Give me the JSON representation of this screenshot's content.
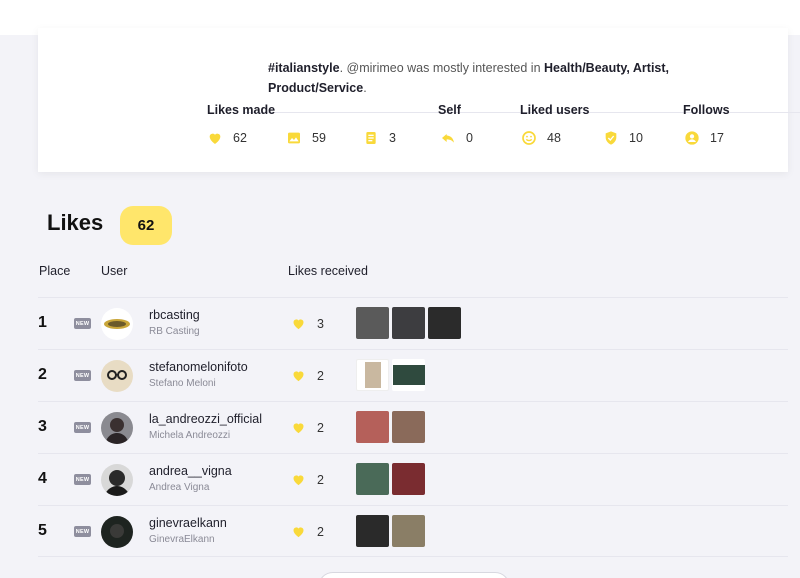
{
  "summary": {
    "hashtag": "#italianstyle",
    "middle_text": ". @mirimeo was mostly interested in ",
    "categories_bold": "Health/Beauty, Artist,",
    "last_category": "Product/Service",
    "end_text": "."
  },
  "stats": {
    "likes_made_label": "Likes made",
    "self_label": "Self",
    "liked_users_label": "Liked users",
    "follows_label": "Follows",
    "items": [
      {
        "icon": "heart-icon",
        "value": "62"
      },
      {
        "icon": "image-icon",
        "value": "59"
      },
      {
        "icon": "document-icon",
        "value": "3"
      },
      {
        "icon": "reply-icon",
        "value": "0"
      },
      {
        "icon": "smiley-icon",
        "value": "48"
      },
      {
        "icon": "shield-check-icon",
        "value": "10"
      },
      {
        "icon": "user-circle-icon",
        "value": "17"
      }
    ]
  },
  "likes_section": {
    "title": "Likes",
    "count": "62",
    "columns": {
      "place": "Place",
      "user": "User",
      "likes_received": "Likes received"
    },
    "new_badge": "NEW",
    "rows": [
      {
        "place": "1",
        "username": "rbcasting",
        "full_name": "RB Casting",
        "likes": "3",
        "thumbs": [
          "#5a5a5a",
          "#3d3d40",
          "#2b2b2b"
        ]
      },
      {
        "place": "2",
        "username": "stefanomelonifoto",
        "full_name": "Stefano Meloni",
        "likes": "2",
        "thumbs": [
          "#c9b8a0",
          "#2f4a3e"
        ]
      },
      {
        "place": "3",
        "username": "la_andreozzi_official",
        "full_name": "Michela Andreozzi",
        "likes": "2",
        "thumbs": [
          "#b5605a",
          "#8a6a5a"
        ]
      },
      {
        "place": "4",
        "username": "andrea__vigna",
        "full_name": "Andrea Vigna",
        "likes": "2",
        "thumbs": [
          "#4a6a58",
          "#7a2c30"
        ]
      },
      {
        "place": "5",
        "username": "ginevraelkann",
        "full_name": "GinevraElkann",
        "likes": "2",
        "thumbs": [
          "#2a2a2a",
          "#8a7e66"
        ]
      }
    ]
  },
  "colors": {
    "accent_yellow": "#ffe66b",
    "icon_yellow": "#f9d93a"
  }
}
